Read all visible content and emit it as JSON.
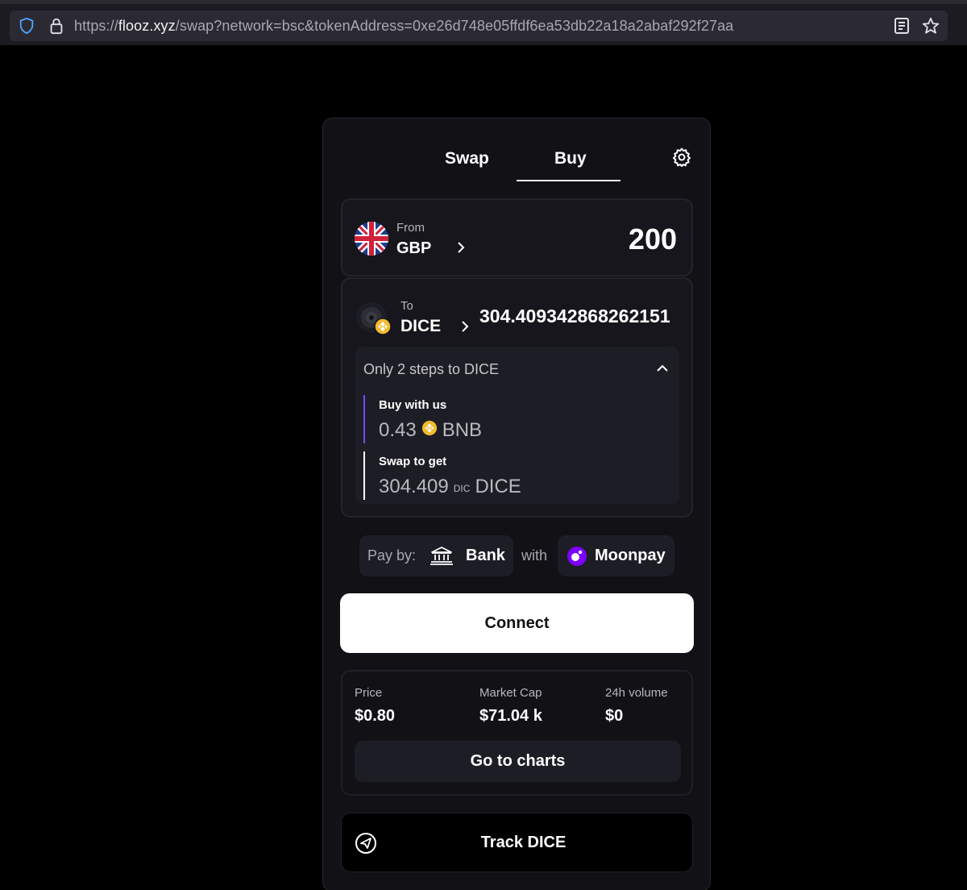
{
  "browser": {
    "url_scheme": "https://",
    "url_host": "flooz.xyz",
    "url_path": "/swap?network=bsc&tokenAddress=0xe26d748e05ffdf6ea53db22a18a2abaf292f27aa",
    "icons": [
      "shield-icon",
      "lock-icon",
      "reader-view-icon",
      "bookmark-star-icon"
    ]
  },
  "tabs": [
    {
      "label": "Swap",
      "active": false
    },
    {
      "label": "Buy",
      "active": true
    }
  ],
  "from": {
    "label": "From",
    "currency": "GBP",
    "amount": "200",
    "icon": "uk-flag-icon"
  },
  "to": {
    "label": "To",
    "currency": "DICE",
    "amount": "304.409342868262151",
    "icon": "dice-token-icon",
    "chain_badge": "bnb-chain-icon"
  },
  "steps": {
    "title": "Only 2 steps to DICE",
    "items": [
      {
        "label": "Buy with us",
        "amount": "0.43",
        "token": "BNB",
        "icon": "bnb-coin-icon"
      },
      {
        "label": "Swap to get",
        "amount": "304.409",
        "token_small": "DIC",
        "token": "DICE"
      }
    ]
  },
  "payment": {
    "pay_by_label": "Pay by:",
    "method": "Bank",
    "with_label": "with",
    "provider": "Moonpay"
  },
  "connect_label": "Connect",
  "stats": [
    {
      "label": "Price",
      "value": "$0.80"
    },
    {
      "label": "Market Cap",
      "value": "$71.04 k"
    },
    {
      "label": "24h volume",
      "value": "$0"
    }
  ],
  "charts_label": "Go to charts",
  "track_label": "Track DICE",
  "colors": {
    "background": "#000000",
    "card": "#111116",
    "panel": "#1d1e25",
    "accent_purple": "#7b45ff",
    "bnb_yellow": "#f3ba2f"
  }
}
